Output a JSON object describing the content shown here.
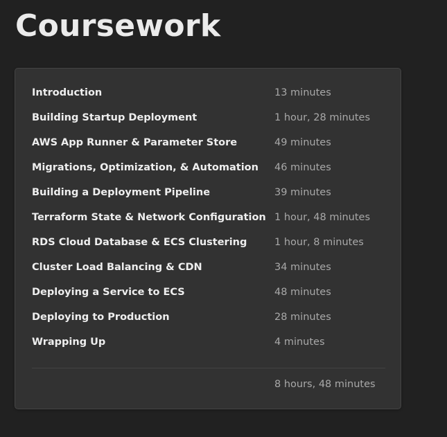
{
  "page": {
    "title": "Coursework"
  },
  "lessons": [
    {
      "title": "Introduction",
      "duration": "13 minutes"
    },
    {
      "title": "Building Startup Deployment",
      "duration": "1 hour, 28 minutes"
    },
    {
      "title": "AWS App Runner & Parameter Store",
      "duration": "49 minutes"
    },
    {
      "title": "Migrations, Optimization, & Automation",
      "duration": "46 minutes"
    },
    {
      "title": "Building a Deployment Pipeline",
      "duration": "39 minutes"
    },
    {
      "title": "Terraform State & Network Configuration",
      "duration": "1 hour, 48 minutes"
    },
    {
      "title": "RDS Cloud Database & ECS Clustering",
      "duration": "1 hour, 8 minutes"
    },
    {
      "title": "Cluster Load Balancing & CDN",
      "duration": "34 minutes"
    },
    {
      "title": "Deploying a Service to ECS",
      "duration": "48 minutes"
    },
    {
      "title": "Deploying to Production",
      "duration": "28 minutes"
    },
    {
      "title": "Wrapping Up",
      "duration": "4 minutes"
    }
  ],
  "summary": {
    "total_duration": "8 hours, 48 minutes"
  },
  "colors": {
    "background": "#212121",
    "card": "#323232",
    "title_text": "#ebebeb",
    "duration_text": "#a9a9a9"
  }
}
